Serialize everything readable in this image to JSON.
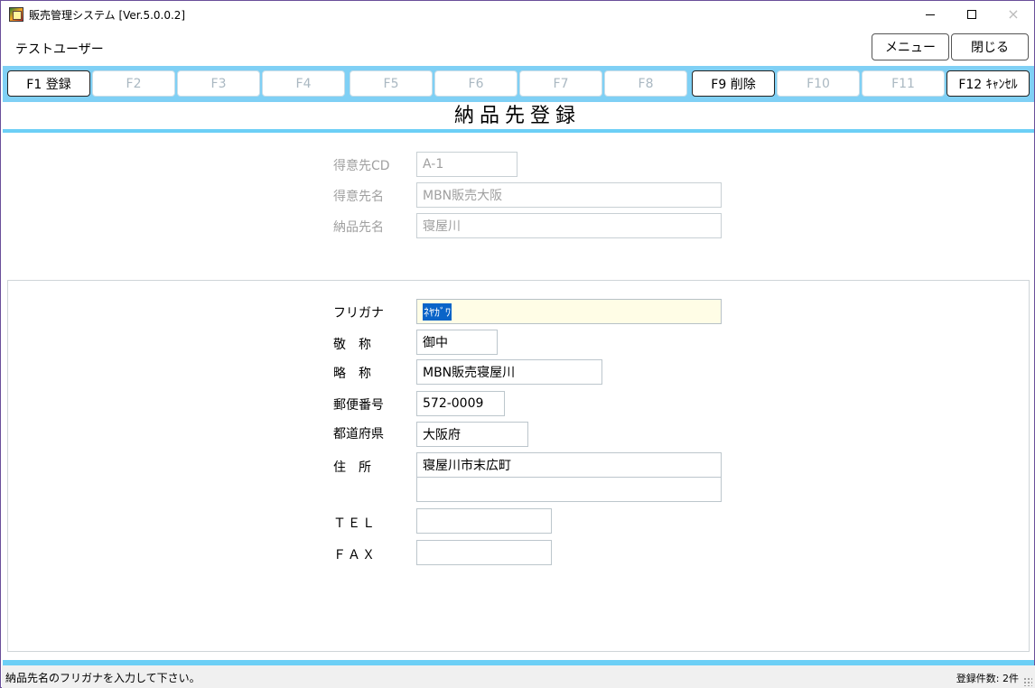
{
  "window": {
    "title": "販売管理システム [Ver.5.0.0.2]",
    "controls": {
      "minimize": "minimize-icon",
      "maximize": "maximize-icon",
      "close": "×"
    }
  },
  "header": {
    "user_name": "テストユーザー",
    "menu_label": "メニュー",
    "close_label": "閉じる"
  },
  "function_keys": [
    {
      "label": "F1 登録",
      "enabled": true
    },
    {
      "label": "F2",
      "enabled": false
    },
    {
      "label": "F3",
      "enabled": false
    },
    {
      "label": "F4",
      "enabled": false
    },
    {
      "label": "F5",
      "enabled": false
    },
    {
      "label": "F6",
      "enabled": false
    },
    {
      "label": "F7",
      "enabled": false
    },
    {
      "label": "F8",
      "enabled": false
    },
    {
      "label": "F9 削除",
      "enabled": true
    },
    {
      "label": "F10",
      "enabled": false
    },
    {
      "label": "F11",
      "enabled": false
    },
    {
      "label": "F12 ｷｬﾝｾﾙ",
      "enabled": true
    }
  ],
  "page_title": "納品先登録",
  "key_fields": {
    "customer_cd": {
      "label": "得意先CD",
      "value": "A-1"
    },
    "customer_name": {
      "label": "得意先名",
      "value": "MBN販売大阪"
    },
    "delivery_name": {
      "label": "納品先名",
      "value": "寝屋川"
    }
  },
  "detail": {
    "furigana": {
      "label": "フリガナ",
      "value": "ﾈﾔｶﾞﾜ"
    },
    "honorific": {
      "label": "敬　称",
      "value": "御中"
    },
    "short_name": {
      "label": "略　称",
      "value": "MBN販売寝屋川"
    },
    "postal_code": {
      "label": "郵便番号",
      "value": "572-0009"
    },
    "prefecture": {
      "label": "都道府県",
      "value": "大阪府"
    },
    "address": {
      "label": "住　所",
      "line1": "寝屋川市末広町",
      "line2": ""
    },
    "tel": {
      "label": "ＴＥＬ",
      "value": ""
    },
    "fax": {
      "label": "ＦＡＸ",
      "value": ""
    }
  },
  "status": {
    "message": "納品先名のフリガナを入力して下さい。",
    "record_count": "登録件数: 2件"
  },
  "colors": {
    "accent": "#7fd0f5",
    "rule": "#6ccff6",
    "active_field": "#fffde6",
    "selection": "#0a64c8",
    "disabled_text": "#a0a0a0"
  }
}
